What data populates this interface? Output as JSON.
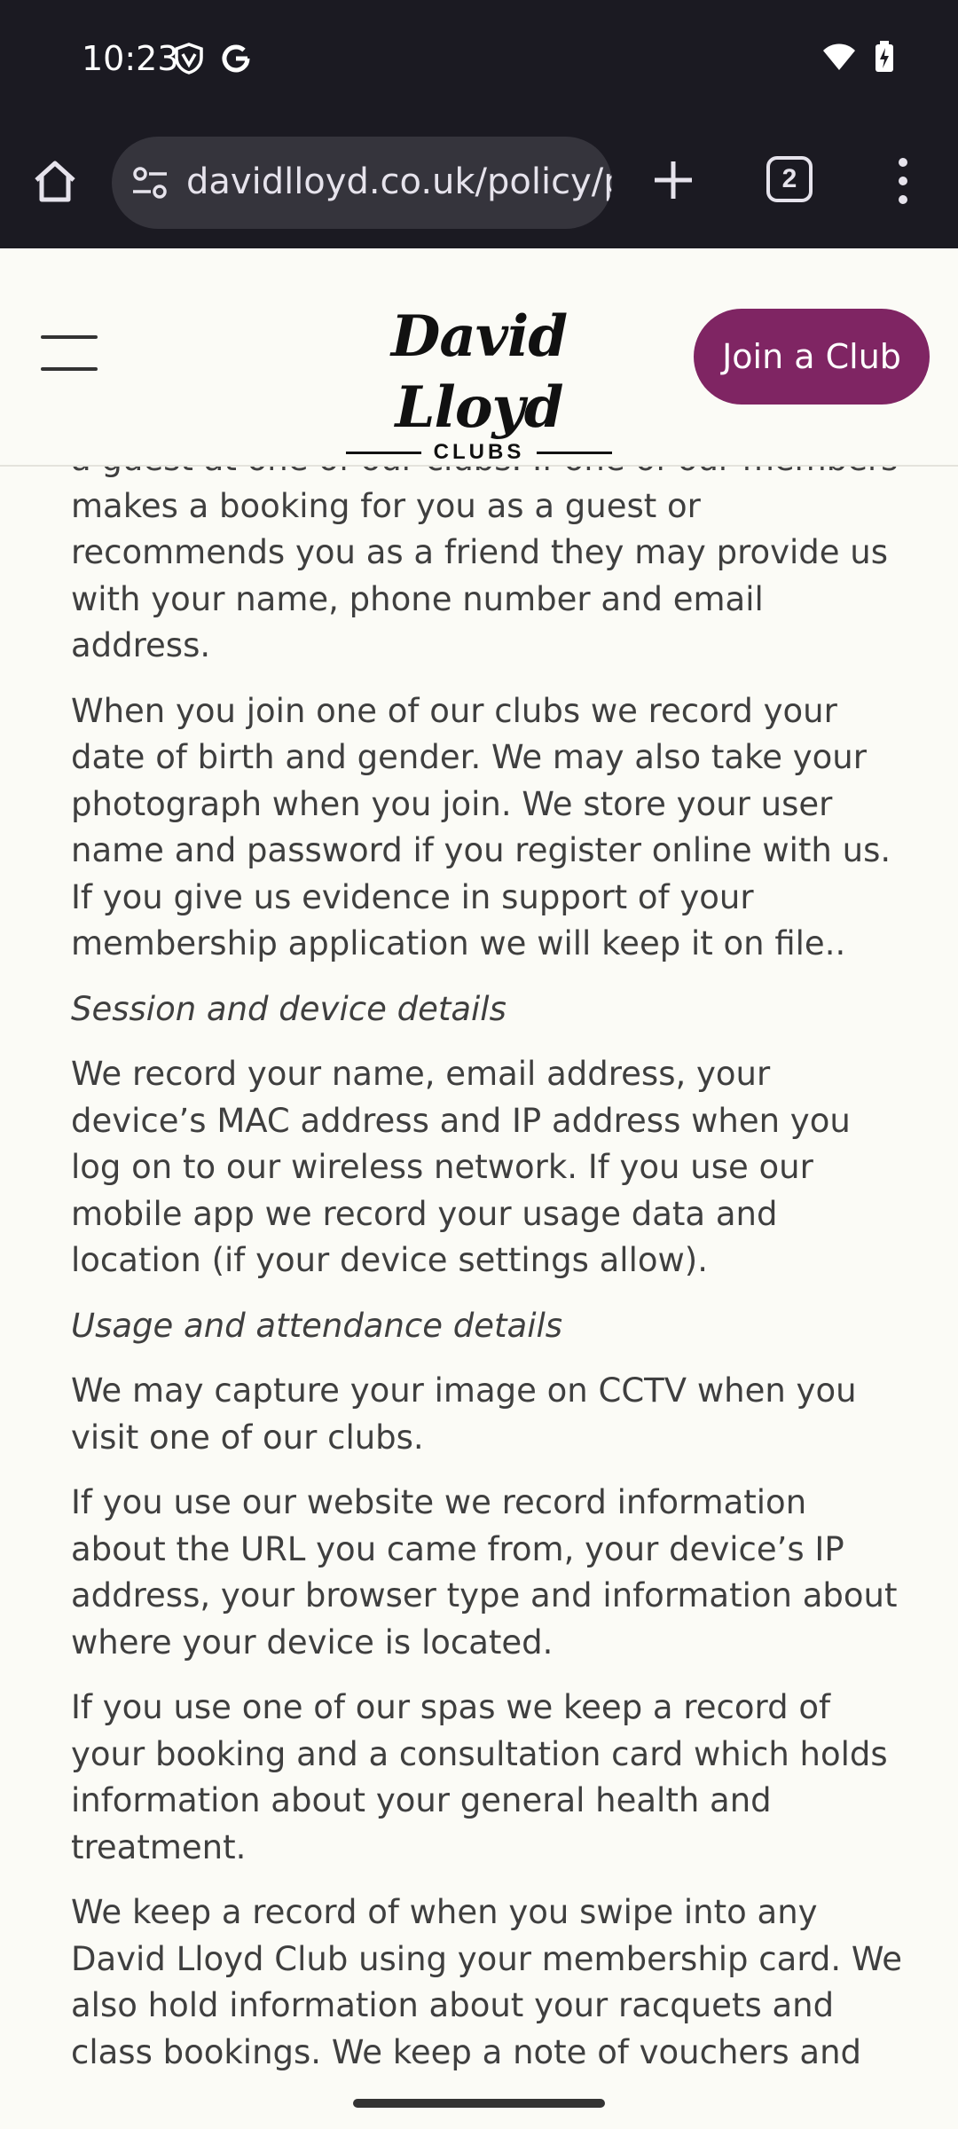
{
  "status_bar": {
    "time": "10:23",
    "left_icons": [
      "vpn-shield-icon",
      "google-icon"
    ],
    "right_icons": [
      "wifi-icon",
      "battery-charging-icon"
    ]
  },
  "browser": {
    "url": "davidlloyd.co.uk/policy/privacy",
    "tab_count": "2",
    "icons": [
      "home-icon",
      "site-settings-icon",
      "plus-icon",
      "tabs-icon",
      "more-vert-icon"
    ]
  },
  "site_header": {
    "logo_script": "David Lloyd",
    "logo_sub": "CLUBS",
    "join_button": "Join a Club",
    "accent_color": "#7f2563"
  },
  "article": {
    "paragraphs": [
      {
        "style": "body",
        "text": "a guest at one of our clubs. If one of our members makes a booking for you as a guest or recommends you as a friend they may provide us with your name, phone number and email address."
      },
      {
        "style": "body",
        "text": "When you join one of our clubs we record your date of birth and gender. We may also take your photograph when you join. We store your user name and password if you register online with us. If you give us evidence in support of your membership application we will keep it on file.."
      },
      {
        "style": "subhead",
        "text": "Session and device details"
      },
      {
        "style": "body",
        "text": "We record your name, email address, your device’s MAC address and IP address when you log on to our wireless network. If you use our mobile app we record your usage data and location (if your device settings allow)."
      },
      {
        "style": "subhead",
        "text": "Usage and attendance details"
      },
      {
        "style": "body",
        "text": "We may capture your image on CCTV when you visit one of our clubs."
      },
      {
        "style": "body",
        "text": "If you use our website we record information about the URL you came from, your device’s IP address, your browser type and information about where your device is located."
      },
      {
        "style": "body",
        "text": "If you use one of our spas we keep a record of your booking and a consultation card which holds information about your general health and treatment."
      },
      {
        "style": "body",
        "text": "We keep a record of when you swipe into any David Lloyd Club using your membership card. We also hold information about your racquets and class bookings. We keep a note of vouchers and guest passes issued to you. We keep a record of"
      }
    ]
  }
}
